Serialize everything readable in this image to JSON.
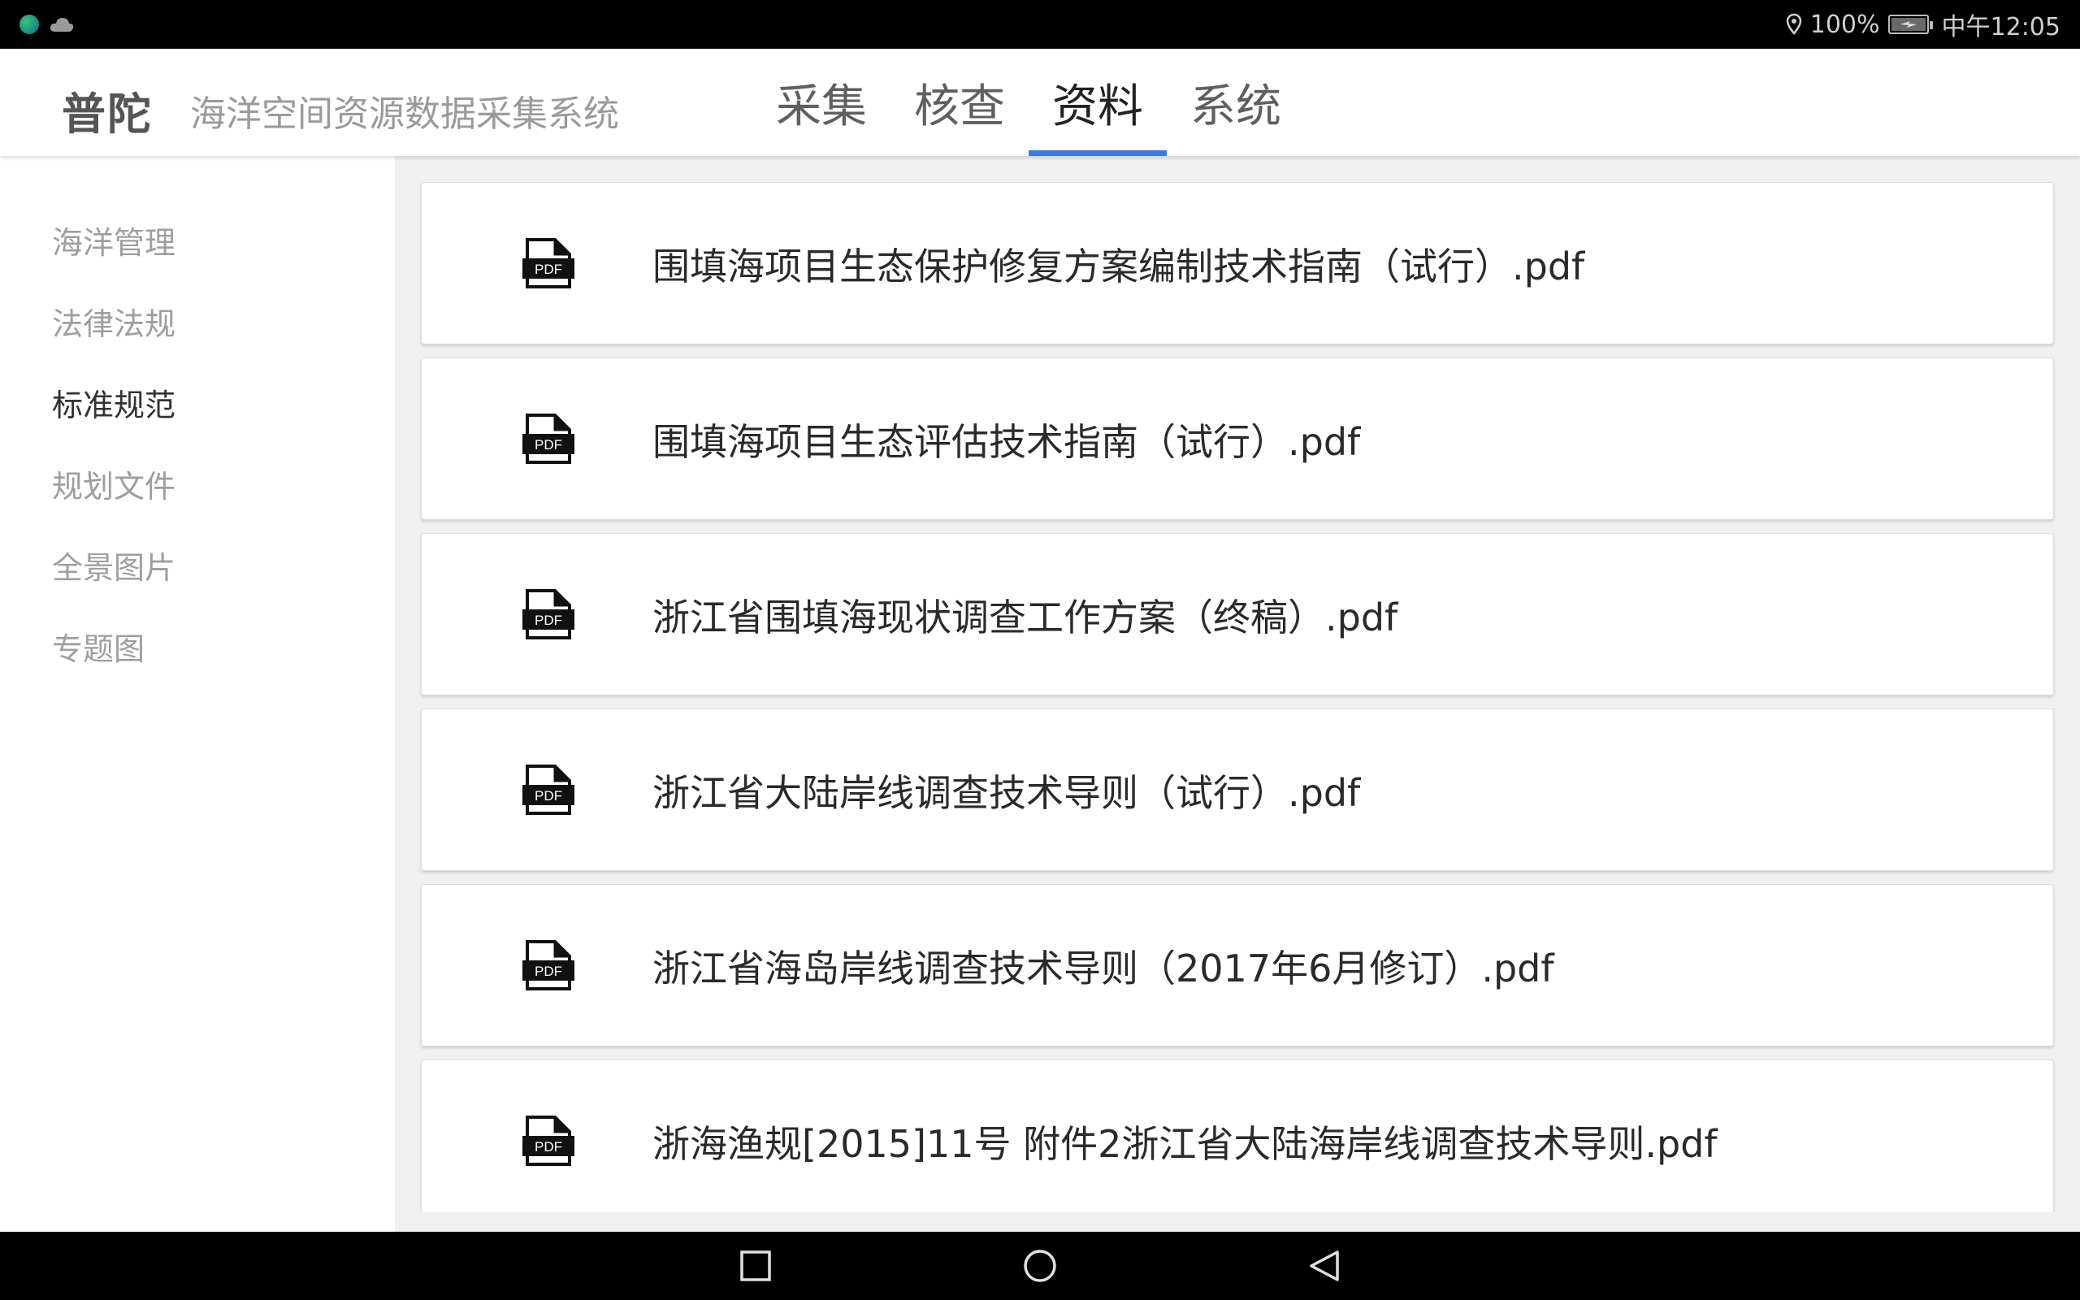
{
  "status_bar": {
    "battery": "100%",
    "time": "中午12:05",
    "icons": [
      "app-icon",
      "cloud-icon",
      "location-icon",
      "battery-icon"
    ]
  },
  "header": {
    "brand": "普陀",
    "subtitle": "海洋空间资源数据采集系统",
    "tabs": [
      {
        "label": "采集"
      },
      {
        "label": "核查"
      },
      {
        "label": "资料"
      },
      {
        "label": "系统"
      }
    ],
    "active_tab": "资料",
    "accent_color": "#3b78e7"
  },
  "sidebar": {
    "items": [
      {
        "label": "海洋管理"
      },
      {
        "label": "法律法规"
      },
      {
        "label": "标准规范"
      },
      {
        "label": "规划文件"
      },
      {
        "label": "全景图片"
      },
      {
        "label": "专题图"
      }
    ],
    "active_item": "标准规范"
  },
  "documents": [
    {
      "title": "围填海项目生态保护修复方案编制技术指南（试行）.pdf",
      "icon": "pdf-icon"
    },
    {
      "title": "围填海项目生态评估技术指南（试行）.pdf",
      "icon": "pdf-icon"
    },
    {
      "title": "浙江省围填海现状调查工作方案（终稿）.pdf",
      "icon": "pdf-icon"
    },
    {
      "title": "浙江省大陆岸线调查技术导则（试行）.pdf",
      "icon": "pdf-icon"
    },
    {
      "title": "浙江省海岛岸线调查技术导则（2017年6月修订）.pdf",
      "icon": "pdf-icon"
    },
    {
      "title": "浙海渔规[2015]11号 附件2浙江省大陆海岸线调查技术导则.pdf",
      "icon": "pdf-icon"
    }
  ],
  "navigation_bar": {
    "buttons": [
      "recents-button",
      "home-button",
      "back-button"
    ]
  }
}
